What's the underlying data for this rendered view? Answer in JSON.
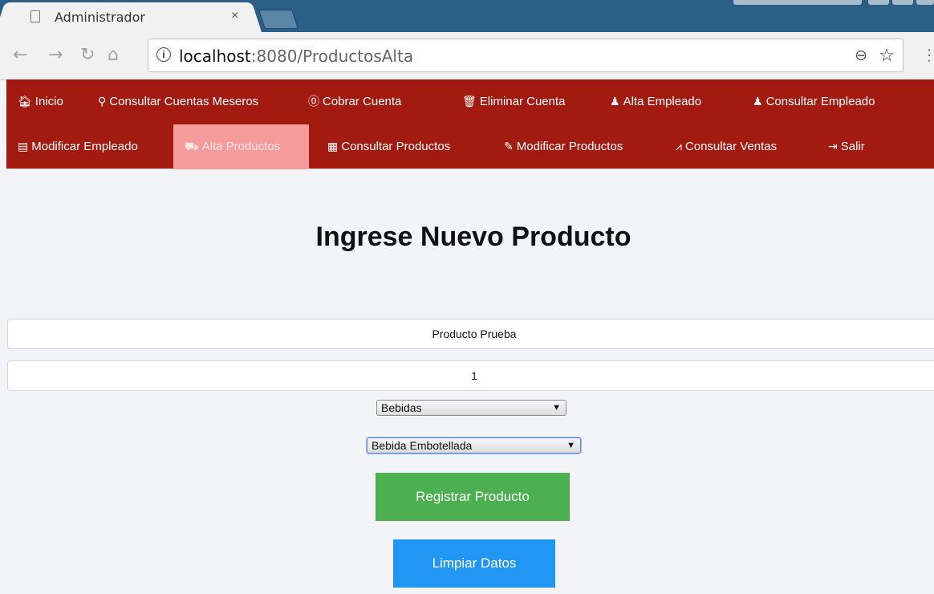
{
  "browser": {
    "tab_title": "Administrador",
    "tab_close": "×",
    "url_host": "localhost",
    "url_path": ":8080/ProductosAlta",
    "info_icon": "i",
    "icons": {
      "back": "back-arrow-icon",
      "forward": "forward-arrow-icon",
      "reload": "reload-icon",
      "home": "home-icon",
      "zoom": "zoom-icon",
      "star": "star-icon"
    }
  },
  "nav": {
    "row1": [
      {
        "icon": "home-icon",
        "glyph": "🏠",
        "label": "Inicio"
      },
      {
        "icon": "search-icon",
        "glyph": "🔍",
        "label": "Consultar Cuentas Meseros"
      },
      {
        "icon": "dollar-icon",
        "glyph": "$",
        "label": "Cobrar Cuenta"
      },
      {
        "icon": "trash-icon",
        "glyph": "🗑",
        "label": "Eliminar Cuenta"
      },
      {
        "icon": "user-add-icon",
        "glyph": "👤",
        "label": "Alta Empleado"
      },
      {
        "icon": "user-icon",
        "glyph": "👤",
        "label": "Consultar Empleado"
      }
    ],
    "row2": [
      {
        "icon": "list-icon",
        "glyph": "▤",
        "label": "Modificar Empleado"
      },
      {
        "icon": "cart-icon",
        "glyph": "🛒",
        "label": "Alta Productos",
        "active": true
      },
      {
        "icon": "binoculars-icon",
        "glyph": "▦",
        "label": "Consultar Productos"
      },
      {
        "icon": "pencil-icon",
        "glyph": "✎",
        "label": "Modificar Productos"
      },
      {
        "icon": "chart-line-icon",
        "glyph": "⩘",
        "label": "Consultar Ventas"
      },
      {
        "icon": "exit-icon",
        "glyph": "⇥",
        "label": "Salir"
      }
    ]
  },
  "form": {
    "title": "Ingrese Nuevo Producto",
    "product_name": "Producto Prueba",
    "quantity": "1",
    "category": "Bebidas",
    "subcategory": "Bebida Embotellada",
    "register_button": "Registrar Producto",
    "clear_button": "Limpiar Datos"
  },
  "colors": {
    "nav_bg": "#a31b10",
    "nav_active": "#f59b9b",
    "register": "#4caf50",
    "clear": "#2196f3",
    "page_bg": "#f3f4f8"
  }
}
